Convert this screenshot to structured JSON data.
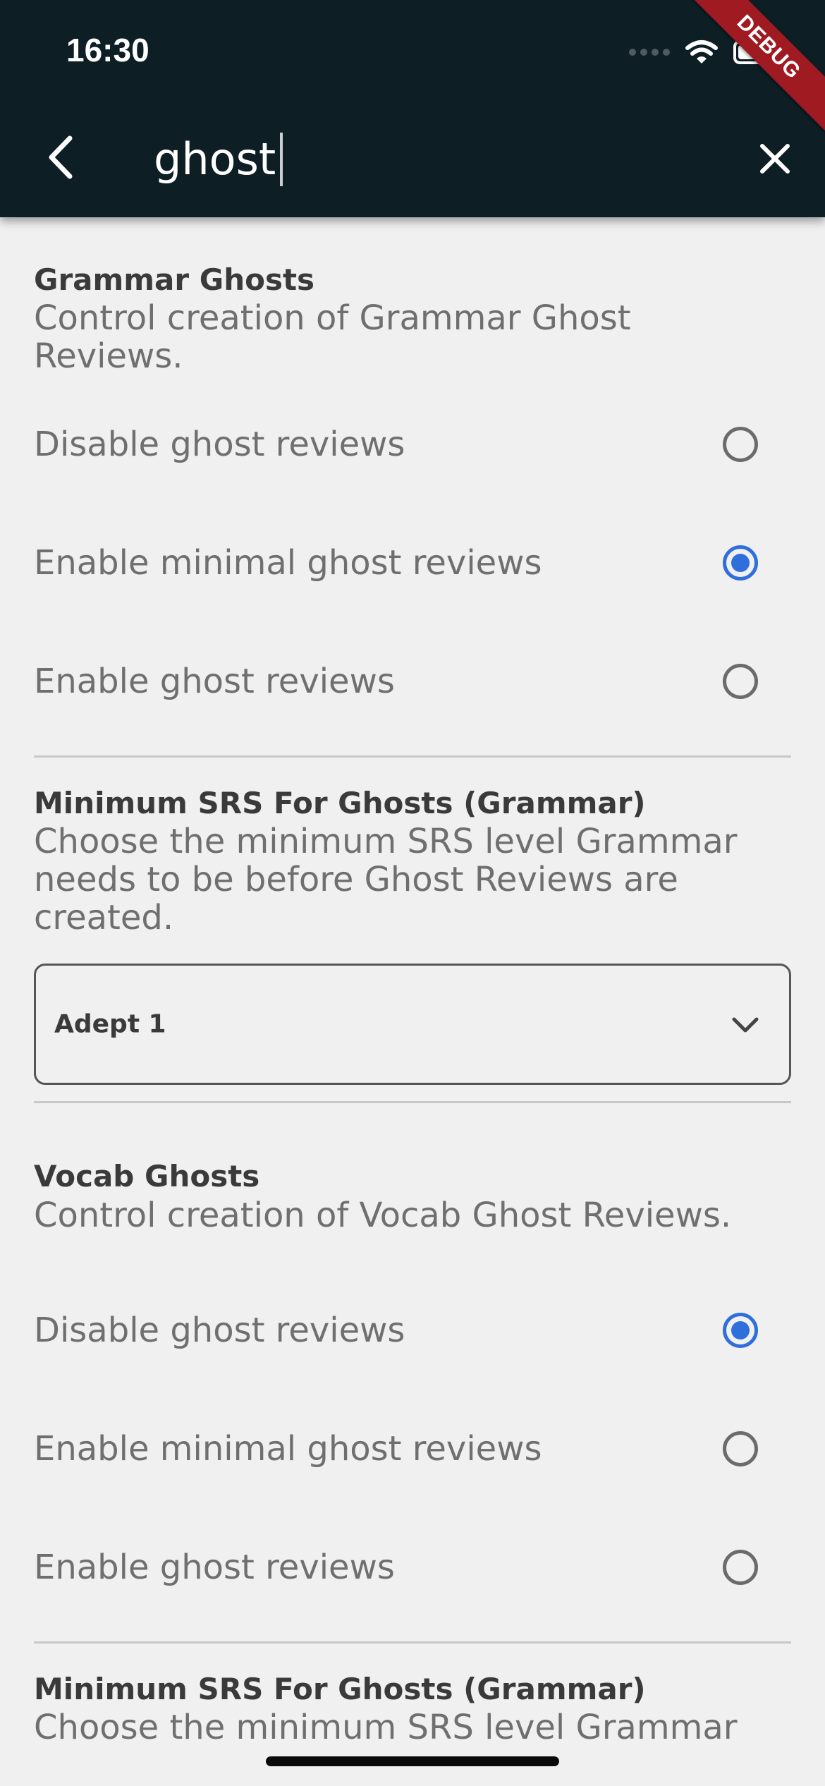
{
  "status_bar": {
    "time": "16:30"
  },
  "debug_banner": "DEBUG",
  "search": {
    "value": "ghost"
  },
  "grammar_ghosts": {
    "title": "Grammar Ghosts",
    "description": "Control creation of Grammar Ghost Reviews.",
    "options": [
      {
        "label": "Disable ghost reviews",
        "selected": false
      },
      {
        "label": "Enable minimal ghost reviews",
        "selected": true
      },
      {
        "label": "Enable ghost reviews",
        "selected": false
      }
    ]
  },
  "min_srs_grammar": {
    "title": "Minimum SRS For Ghosts (Grammar)",
    "description": "Choose the minimum SRS level Grammar needs to be before Ghost Reviews are created.",
    "selected_value": "Adept 1"
  },
  "vocab_ghosts": {
    "title": "Vocab Ghosts",
    "description": "Control creation of Vocab Ghost Reviews.",
    "options": [
      {
        "label": "Disable ghost reviews",
        "selected": true
      },
      {
        "label": "Enable minimal ghost reviews",
        "selected": false
      },
      {
        "label": "Enable ghost reviews",
        "selected": false
      }
    ]
  },
  "min_srs_vocab": {
    "title": "Minimum SRS For Ghosts (Grammar)",
    "description": "Choose the minimum SRS level Grammar"
  },
  "colors": {
    "appbar": "#0d1e25",
    "accent": "#2f6fdc",
    "background": "#f0f0f0",
    "debug": "#a01a22"
  }
}
